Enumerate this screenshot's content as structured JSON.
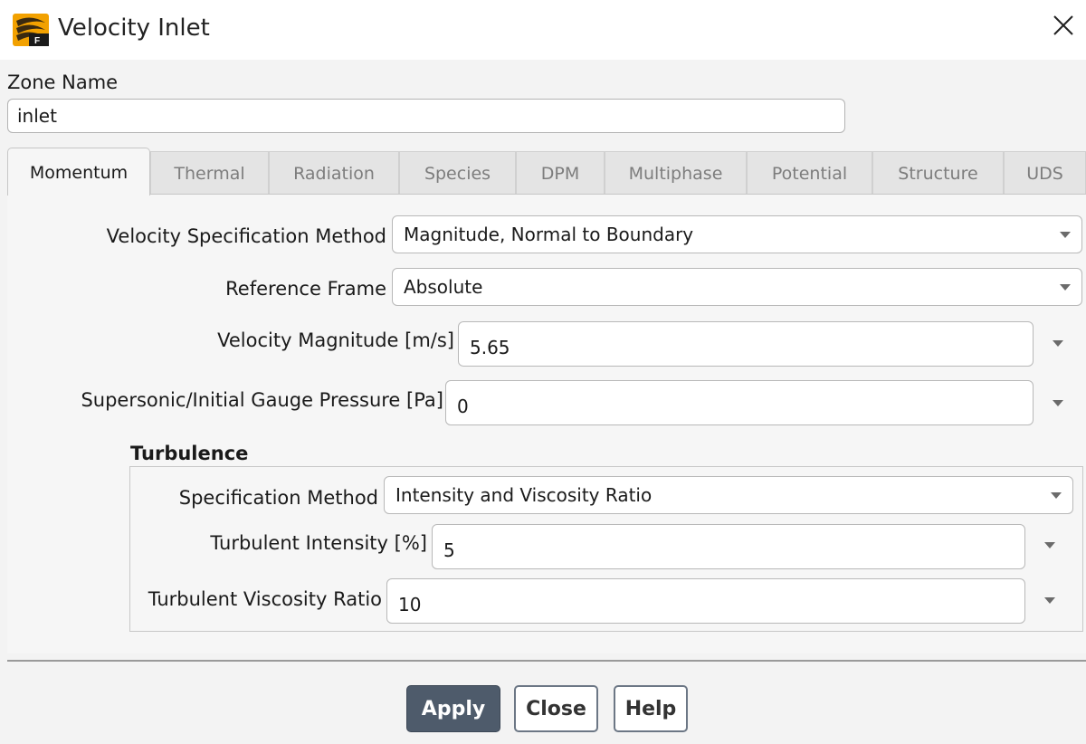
{
  "window": {
    "title": "Velocity Inlet"
  },
  "zone": {
    "label": "Zone Name",
    "value": "inlet"
  },
  "tabs": [
    {
      "label": "Momentum",
      "active": true
    },
    {
      "label": "Thermal",
      "active": false
    },
    {
      "label": "Radiation",
      "active": false
    },
    {
      "label": "Species",
      "active": false
    },
    {
      "label": "DPM",
      "active": false
    },
    {
      "label": "Multiphase",
      "active": false
    },
    {
      "label": "Potential",
      "active": false
    },
    {
      "label": "Structure",
      "active": false
    },
    {
      "label": "UDS",
      "active": false
    }
  ],
  "momentum": {
    "velocity_spec_method": {
      "label": "Velocity Specification Method",
      "value": "Magnitude, Normal to Boundary"
    },
    "reference_frame": {
      "label": "Reference Frame",
      "value": "Absolute"
    },
    "velocity_magnitude": {
      "label": "Velocity Magnitude [m/s]",
      "value": "5.65"
    },
    "gauge_pressure": {
      "label": "Supersonic/Initial Gauge Pressure [Pa]",
      "value": "0"
    }
  },
  "turbulence": {
    "heading": "Turbulence",
    "spec_method": {
      "label": "Specification Method",
      "value": "Intensity and Viscosity Ratio"
    },
    "intensity": {
      "label": "Turbulent Intensity [%]",
      "value": "5"
    },
    "viscosity_ratio": {
      "label": "Turbulent Viscosity Ratio",
      "value": "10"
    }
  },
  "buttons": {
    "apply": "Apply",
    "close": "Close",
    "help": "Help"
  },
  "colors": {
    "apply_bg": "#4e5b6b",
    "background": "#f3f3f3"
  }
}
